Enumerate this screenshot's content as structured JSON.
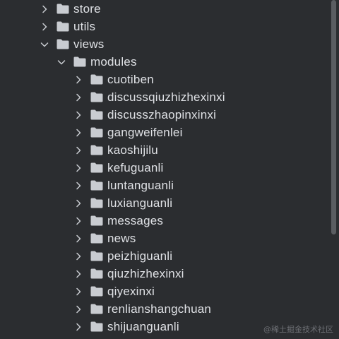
{
  "tree": {
    "items": [
      {
        "label": "store",
        "depth": 0,
        "expanded": false
      },
      {
        "label": "utils",
        "depth": 0,
        "expanded": false
      },
      {
        "label": "views",
        "depth": 0,
        "expanded": true
      },
      {
        "label": "modules",
        "depth": 1,
        "expanded": true
      },
      {
        "label": "cuotiben",
        "depth": 2,
        "expanded": false
      },
      {
        "label": "discussqiuzhizhexinxi",
        "depth": 2,
        "expanded": false
      },
      {
        "label": "discusszhaopinxinxi",
        "depth": 2,
        "expanded": false
      },
      {
        "label": "gangweifenlei",
        "depth": 2,
        "expanded": false
      },
      {
        "label": "kaoshijilu",
        "depth": 2,
        "expanded": false
      },
      {
        "label": "kefuguanli",
        "depth": 2,
        "expanded": false
      },
      {
        "label": "luntanguanli",
        "depth": 2,
        "expanded": false
      },
      {
        "label": "luxianguanli",
        "depth": 2,
        "expanded": false
      },
      {
        "label": "messages",
        "depth": 2,
        "expanded": false
      },
      {
        "label": "news",
        "depth": 2,
        "expanded": false
      },
      {
        "label": "peizhiguanli",
        "depth": 2,
        "expanded": false
      },
      {
        "label": "qiuzhizhexinxi",
        "depth": 2,
        "expanded": false
      },
      {
        "label": "qiyexinxi",
        "depth": 2,
        "expanded": false
      },
      {
        "label": "renlianshangchuan",
        "depth": 2,
        "expanded": false
      },
      {
        "label": "shijuanguanli",
        "depth": 2,
        "expanded": false
      }
    ]
  },
  "watermark": "@稀土掘金技术社区",
  "colors": {
    "background": "#2b2d30",
    "text": "#dfe1e5",
    "folder": "#c9ccd1",
    "chevron": "#c9ccd1",
    "scrollbar": "#5a5d61"
  },
  "icons": {
    "collapsed": "chevron-right-icon",
    "expanded": "chevron-down-icon",
    "folder": "folder-icon"
  }
}
